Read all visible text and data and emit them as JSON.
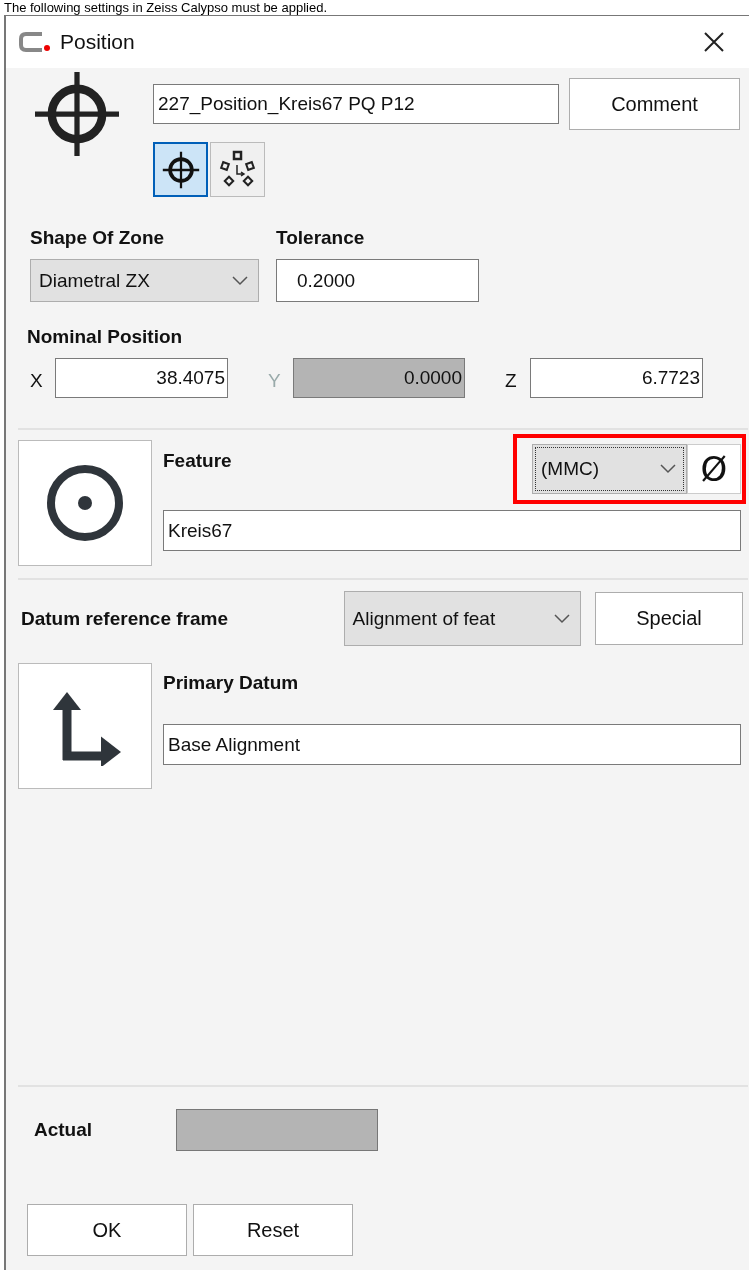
{
  "caption": "The following settings in Zeiss Calypso must be applied.",
  "window": {
    "title": "Position"
  },
  "name_field": {
    "value": "227_Position_Kreis67 PQ P12"
  },
  "comment_button": "Comment",
  "mode_buttons": [
    {
      "kind": "crosshair",
      "selected": true
    },
    {
      "kind": "pattern",
      "selected": false
    }
  ],
  "shape_of_zone": {
    "label": "Shape Of Zone",
    "value": "Diametral ZX"
  },
  "tolerance": {
    "label": "Tolerance",
    "value": "0.2000"
  },
  "nominal_position": {
    "label": "Nominal Position",
    "coords": [
      {
        "axis": "X",
        "value": "38.4075",
        "disabled": false
      },
      {
        "axis": "Y",
        "value": "0.0000",
        "disabled": true
      },
      {
        "axis": "Z",
        "value": "6.7723",
        "disabled": false
      }
    ]
  },
  "feature": {
    "label": "Feature",
    "material_condition": "(MMC)",
    "diameter_symbol": "Ø",
    "highlighted": true,
    "value": "Kreis67"
  },
  "datum_reference_frame": {
    "label": "Datum reference frame",
    "value": "Alignment of feat",
    "special_button": "Special"
  },
  "primary_datum": {
    "label": "Primary Datum",
    "value": "Base Alignment"
  },
  "actual": {
    "label": "Actual",
    "disabled": true
  },
  "buttons": [
    "OK",
    "Reset"
  ]
}
